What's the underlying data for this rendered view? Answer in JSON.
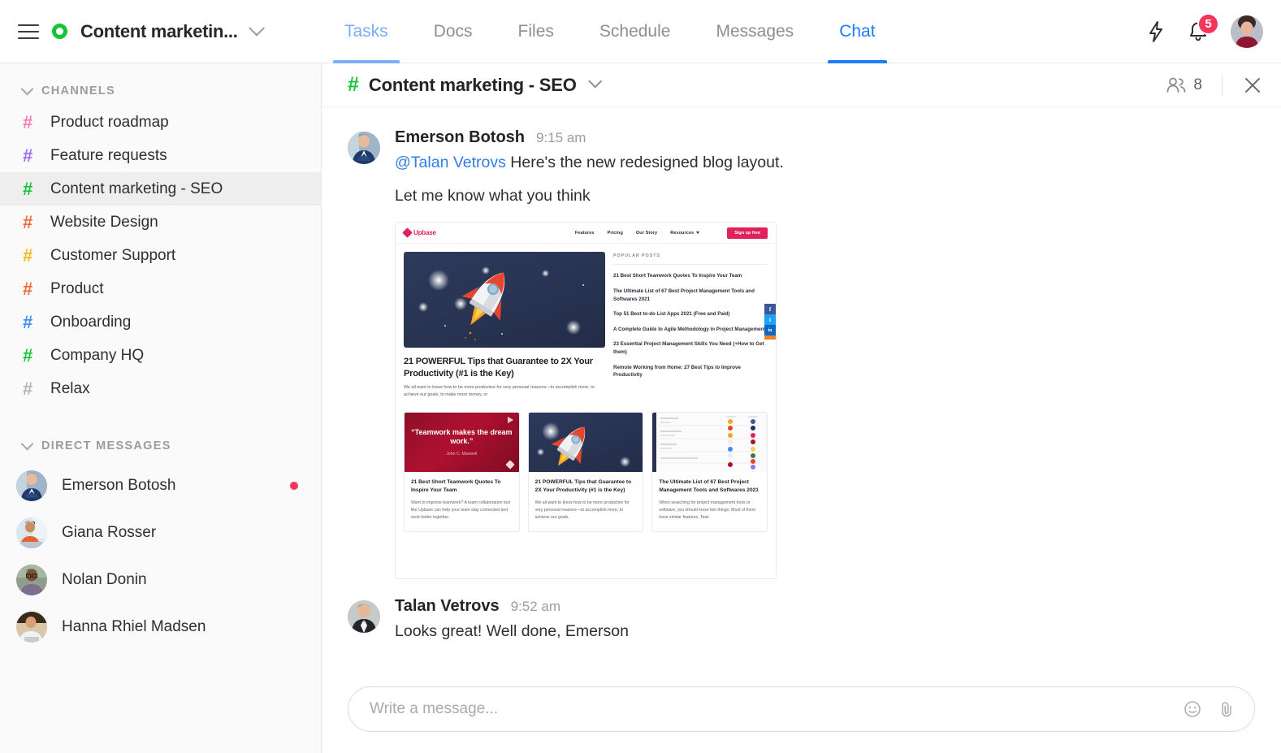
{
  "topbar": {
    "menu_icon": "hamburger-icon",
    "workspace_status_icon": "green-circle-icon",
    "workspace_name": "Content marketin...",
    "workspace_chevron_icon": "chevron-down-icon",
    "bolt_icon": "lightning-bolt-icon",
    "bell_icon": "bell-icon",
    "notification_count": "5",
    "avatar_name": "user-avatar",
    "tabs": [
      {
        "label": "Tasks",
        "state": "hover"
      },
      {
        "label": "Docs",
        "state": "default"
      },
      {
        "label": "Files",
        "state": "default"
      },
      {
        "label": "Schedule",
        "state": "default"
      },
      {
        "label": "Messages",
        "state": "default"
      },
      {
        "label": "Chat",
        "state": "active"
      }
    ]
  },
  "sidebar": {
    "channels_section": {
      "title": "CHANNELS",
      "chevron_icon": "chevron-down-icon",
      "items": [
        {
          "label": "Product roadmap",
          "hash_color": "#f77fb4",
          "selected": false
        },
        {
          "label": "Feature requests",
          "hash_color": "#9b6ef3",
          "selected": false
        },
        {
          "label": "Content marketing - SEO",
          "hash_color": "#18c437",
          "selected": true
        },
        {
          "label": "Website Design",
          "hash_color": "#f2693c",
          "selected": false
        },
        {
          "label": "Customer Support",
          "hash_color": "#f5b820",
          "selected": false
        },
        {
          "label": "Product",
          "hash_color": "#f2693c",
          "selected": false
        },
        {
          "label": "Onboarding",
          "hash_color": "#3c8ef5",
          "selected": false
        },
        {
          "label": "Company HQ",
          "hash_color": "#18c437",
          "selected": false
        },
        {
          "label": "Relax",
          "hash_color": "#b4b4bc",
          "selected": false
        }
      ]
    },
    "dm_section": {
      "title": "DIRECT MESSAGES",
      "chevron_icon": "chevron-down-icon",
      "items": [
        {
          "name": "Emerson Botosh",
          "unread": true
        },
        {
          "name": "Giana Rosser",
          "unread": false
        },
        {
          "name": "Nolan Donin",
          "unread": false
        },
        {
          "name": "Hanna Rhiel Madsen",
          "unread": false
        }
      ]
    }
  },
  "channel_header": {
    "hash_icon": "hash-icon",
    "title": "Content marketing - SEO",
    "chevron_icon": "chevron-down-icon",
    "members_icon": "people-icon",
    "members_count": "8",
    "close_icon": "close-icon"
  },
  "messages": [
    {
      "author": "Emerson Botosh",
      "time": "9:15 am",
      "mention": "@Talan Vetrovs",
      "text": " Here's the new redesigned blog layout.",
      "second_line": "Let me know what you think",
      "has_attachment": true
    },
    {
      "author": "Talan Vetrovs",
      "time": "9:52 am",
      "mention": "",
      "text": "Looks great! Well done, Emerson",
      "second_line": "",
      "has_attachment": false
    }
  ],
  "attachment_preview": {
    "site_name": "Upbase",
    "logo_icon": "upbase-diamond-logo",
    "nav_links": [
      "Features",
      "Pricing",
      "Our Story",
      "Resources"
    ],
    "resources_caret_icon": "caret-down-icon",
    "cta_label": "Sign up free",
    "hero": {
      "image_alt": "rocket-illustration",
      "title": "21 POWERFUL Tips that Guarantee to 2X Your Productivity (#1 is the Key)",
      "excerpt": "We all want to know how to be more productive for very personal reasons—to accomplish more, to achieve our goals, to make more money, or"
    },
    "sidebar": {
      "heading": "POPULAR POSTS",
      "posts": [
        "21 Best Short Teamwork Quotes To Inspire Your Team",
        "The Ultimate List of 67 Best Project Management Tools and Softwares 2021",
        "Top 51 Best to-do List Apps 2021 (Free and Paid)",
        "A Complete Guide to Agile Methodology in Project Management",
        "23 Essential Project Management Skills You Need (+How to Get them)",
        "Remote Working from Home: 27 Best Tips to Improve Productivity"
      ]
    },
    "social_buttons": [
      {
        "name": "facebook-icon",
        "glyph": "f",
        "color": "#3b5998"
      },
      {
        "name": "twitter-icon",
        "glyph": "t",
        "color": "#1da1f2"
      },
      {
        "name": "linkedin-icon",
        "glyph": "in",
        "color": "#0a66c2"
      },
      {
        "name": "more-share-icon",
        "glyph": "",
        "color": "#f08123"
      }
    ],
    "cards": [
      {
        "image_type": "quote",
        "quote_text": "“Teamwork makes the dream work.”",
        "quote_author": "John C. Maxwell",
        "title": "21 Best Short Teamwork Quotes To Inspire Your Team",
        "excerpt": "Want to improve teamwork? A team collaboration tool like Upbase can help your team stay connected and work better together."
      },
      {
        "image_type": "rocket",
        "quote_text": "",
        "quote_author": "",
        "title": "21 POWERFUL Tips that Guarantee to 2X Your Productivity (#1 is the Key)",
        "excerpt": "We all want to know how to be more productive for very personal reasons—to accomplish more, to achieve our goals,"
      },
      {
        "image_type": "dashboard",
        "quote_text": "",
        "quote_author": "",
        "title": "The Ultimate List of 67 Best Project Management Tools and Softwares 2021",
        "excerpt": "When searching for project management tools or software, you should know two things: Most of them have similar features. Task"
      }
    ]
  },
  "composer": {
    "placeholder": "Write a message...",
    "value": "",
    "emoji_icon": "emoji-icon",
    "attach_icon": "paperclip-icon"
  },
  "colors": {
    "accent_blue": "#1a7ef5",
    "hover_blue": "#7aaef7",
    "green": "#18c437",
    "red": "#f5365c",
    "brand_pink": "#e0215c"
  }
}
